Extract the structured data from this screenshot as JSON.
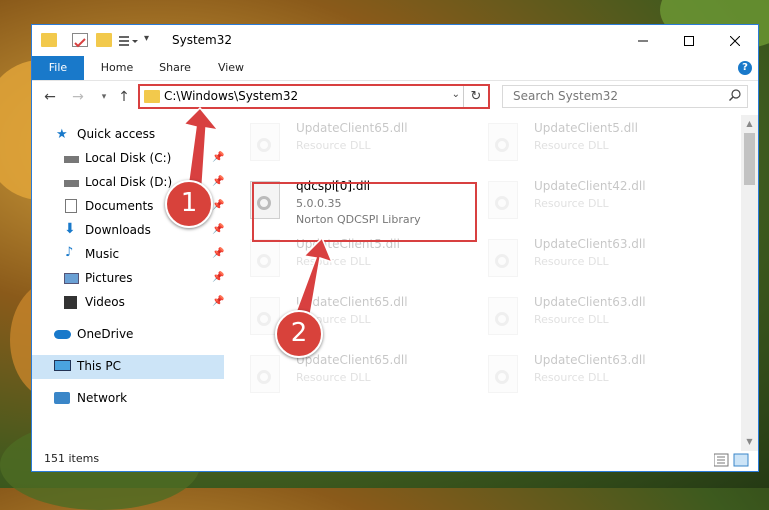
{
  "window": {
    "title": "System32",
    "accent": "#1979ca"
  },
  "ribbon": {
    "tabs": [
      "File",
      "Home",
      "Share",
      "View"
    ],
    "help_label": "?"
  },
  "nav": {
    "address_path": "C:\\Windows\\System32",
    "search_placeholder": "Search System32"
  },
  "sidebar": {
    "items": [
      {
        "label": "Quick access",
        "icon": "star-icon",
        "pinned": false
      },
      {
        "label": "Local Disk (C:)",
        "icon": "drive-icon",
        "pinned": true
      },
      {
        "label": "Local Disk (D:)",
        "icon": "drive-icon",
        "pinned": true
      },
      {
        "label": "Documents",
        "icon": "documents-icon",
        "pinned": true
      },
      {
        "label": "Downloads",
        "icon": "download-icon",
        "pinned": true
      },
      {
        "label": "Music",
        "icon": "music-icon",
        "pinned": true
      },
      {
        "label": "Pictures",
        "icon": "pictures-icon",
        "pinned": true
      },
      {
        "label": "Videos",
        "icon": "videos-icon",
        "pinned": true
      },
      {
        "label": "OneDrive",
        "icon": "cloud-icon",
        "pinned": false
      },
      {
        "label": "This PC",
        "icon": "computer-icon",
        "pinned": false,
        "selected": true
      },
      {
        "label": "Network",
        "icon": "network-icon",
        "pinned": false
      }
    ]
  },
  "files": {
    "highlighted": {
      "name": "qdcspi[0].dll",
      "version": "5.0.0.35",
      "description": "Norton QDCSPI  Library"
    },
    "others": [
      {
        "name": "UpdateClient65.dll",
        "type": "Resource DLL"
      },
      {
        "name": "UpdateClient5.dll",
        "type": "Resource DLL"
      },
      {
        "name": "UpdateClient42.dll",
        "type": "Resource DLL"
      },
      {
        "name": "UpdateClient5.dll",
        "type": "Resource DLL"
      },
      {
        "name": "UpdateClient63.dll",
        "type": "Resource DLL"
      },
      {
        "name": "UpdateClient65.dll",
        "type": "Resource DLL"
      },
      {
        "name": "UpdateClient63.dll",
        "type": "Resource DLL"
      },
      {
        "name": "UpdateClient65.dll",
        "type": "Resource DLL"
      },
      {
        "name": "UpdateClient63.dll",
        "type": "Resource DLL"
      }
    ]
  },
  "status": {
    "item_count": "151 items"
  },
  "callouts": [
    "1",
    "2"
  ]
}
